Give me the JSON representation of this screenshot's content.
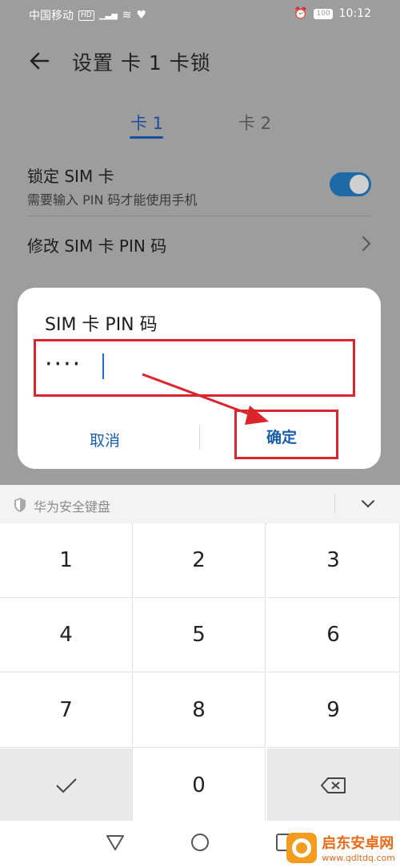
{
  "status_bar": {
    "carrier": "中国移动",
    "hd": "HD",
    "signal": "4G",
    "battery": "100",
    "time": "10:12"
  },
  "header": {
    "title": "设置 卡 1 卡锁"
  },
  "tabs": [
    {
      "label": "卡 1",
      "selected": true
    },
    {
      "label": "卡 2",
      "selected": false
    }
  ],
  "settings": {
    "lock_sim": {
      "title": "锁定 SIM 卡",
      "subtitle": "需要输入 PIN 码才能使用手机",
      "enabled": true
    },
    "change_pin": {
      "title": "修改 SIM 卡 PIN 码"
    }
  },
  "dialog": {
    "title": "SIM 卡 PIN 码",
    "pin_value": "····",
    "cancel_label": "取消",
    "confirm_label": "确定"
  },
  "keyboard": {
    "title": "华为安全键盘",
    "keys": [
      "1",
      "2",
      "3",
      "4",
      "5",
      "6",
      "7",
      "8",
      "9",
      "",
      "0",
      ""
    ]
  },
  "watermark": {
    "title": "启东安卓网",
    "url": "www.qdltdq.com"
  },
  "colors": {
    "accent": "#1a4f9e",
    "highlight_box": "#d9252b",
    "toggle_on": "#1d6aa7"
  }
}
